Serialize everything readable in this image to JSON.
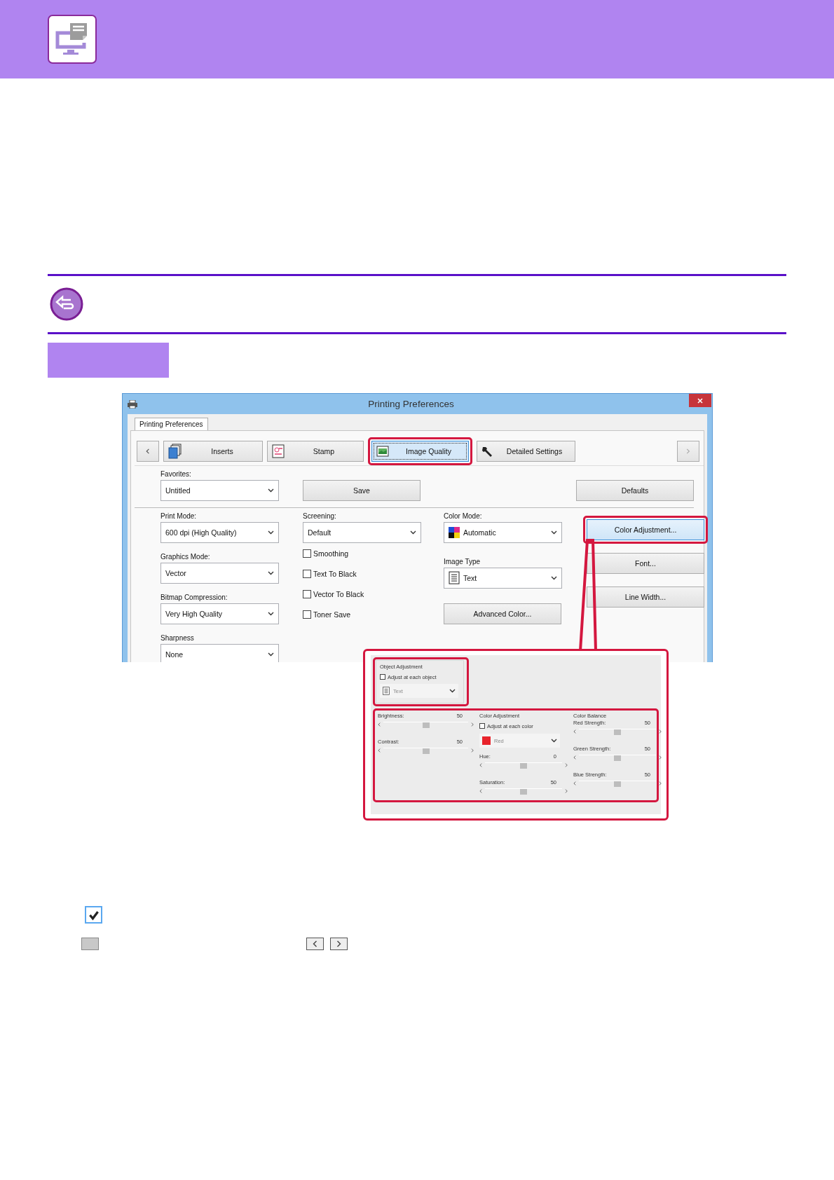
{
  "dialog": {
    "title": "Printing Preferences",
    "tab": "Printing Preferences",
    "toolbar": [
      {
        "label": "Inserts",
        "selected": false
      },
      {
        "label": "Stamp",
        "selected": false
      },
      {
        "label": "Image Quality",
        "selected": true
      },
      {
        "label": "Detailed Settings",
        "selected": false
      }
    ],
    "favorites": {
      "label": "Favorites:",
      "value": "Untitled"
    },
    "save": "Save",
    "defaults": "Defaults",
    "columns": [
      [
        {
          "kind": "select",
          "label": "Print Mode:",
          "value": "600 dpi (High Quality)"
        },
        {
          "kind": "select",
          "label": "Graphics Mode:",
          "value": "Vector"
        },
        {
          "kind": "select",
          "label": "Bitmap Compression:",
          "value": "Very High Quality"
        },
        {
          "kind": "select",
          "label": "Sharpness",
          "value": "None"
        }
      ],
      [
        {
          "kind": "select",
          "label": "Screening:",
          "value": "Default"
        },
        {
          "kind": "checkbox",
          "label": "Smoothing",
          "checked": false
        },
        {
          "kind": "checkbox",
          "label": "Text To Black",
          "checked": false
        },
        {
          "kind": "checkbox",
          "label": "Vector To Black",
          "checked": false
        },
        {
          "kind": "checkbox",
          "label": "Toner Save",
          "checked": false
        }
      ],
      [
        {
          "kind": "colorselect",
          "label": "Color Mode:",
          "value": "Automatic"
        },
        {
          "kind": "docselect",
          "label": "Image Type",
          "value": "Text"
        },
        {
          "kind": "button",
          "label": "Advanced Color...",
          "highlighted": false
        }
      ],
      [
        {
          "kind": "button",
          "label": "Color Adjustment...",
          "highlighted": true
        },
        {
          "kind": "button",
          "label": "Font...",
          "highlighted": false
        },
        {
          "kind": "button",
          "label": "Line Width...",
          "highlighted": false
        }
      ]
    ]
  },
  "detail": {
    "object_adjustment": {
      "title": "Object Adjustment",
      "checkbox": {
        "label": "Adjust at each object",
        "checked": false
      },
      "value": "Text"
    },
    "basic": [
      {
        "label": "Brightness:",
        "reading": "50",
        "level": 0.5
      },
      {
        "label": "Contrast:",
        "reading": "50",
        "level": 0.5
      }
    ],
    "color_adjustment": {
      "title": "Color Adjustment",
      "checkbox": {
        "label": "Adjust at each color",
        "checked": false
      },
      "value": "Red",
      "color": "#e8232b",
      "sliders": [
        {
          "label": "Hue:",
          "reading": "0",
          "level": 0.5
        },
        {
          "label": "Saturation:",
          "reading": "50",
          "level": 0.5
        }
      ]
    },
    "color_balance": {
      "title": "Color Balance",
      "sliders": [
        {
          "label": "Red Strength:",
          "reading": "50",
          "level": 0.5
        },
        {
          "label": "Green Strength:",
          "reading": "50",
          "level": 0.5
        },
        {
          "label": "Blue Strength:",
          "reading": "50",
          "level": 0.5
        }
      ]
    }
  }
}
